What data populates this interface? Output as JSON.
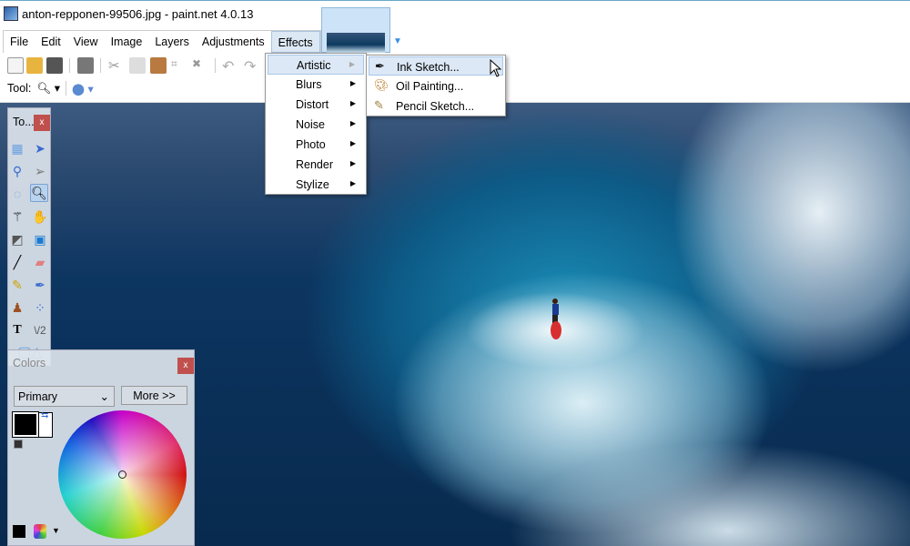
{
  "window": {
    "title": "anton-repponen-99506.jpg - paint.net 4.0.13"
  },
  "menubar": {
    "items": [
      "File",
      "Edit",
      "View",
      "Image",
      "Layers",
      "Adjustments",
      "Effects"
    ],
    "active": "Effects"
  },
  "toolbar": {
    "tool_label": "Tool:"
  },
  "tools_window": {
    "title": "To...",
    "close": "x"
  },
  "colors_window": {
    "title": "Colors",
    "close": "x",
    "mode": "Primary",
    "more_label": "More >>",
    "primary_color": "#000000",
    "secondary_color": "#ffffff"
  },
  "effects_menu": {
    "items": [
      "Artistic",
      "Blurs",
      "Distort",
      "Noise",
      "Photo",
      "Render",
      "Stylize"
    ],
    "highlighted": "Artistic"
  },
  "artistic_submenu": {
    "items": [
      "Ink Sketch...",
      "Oil Painting...",
      "Pencil Sketch..."
    ],
    "highlighted": "Ink Sketch..."
  }
}
